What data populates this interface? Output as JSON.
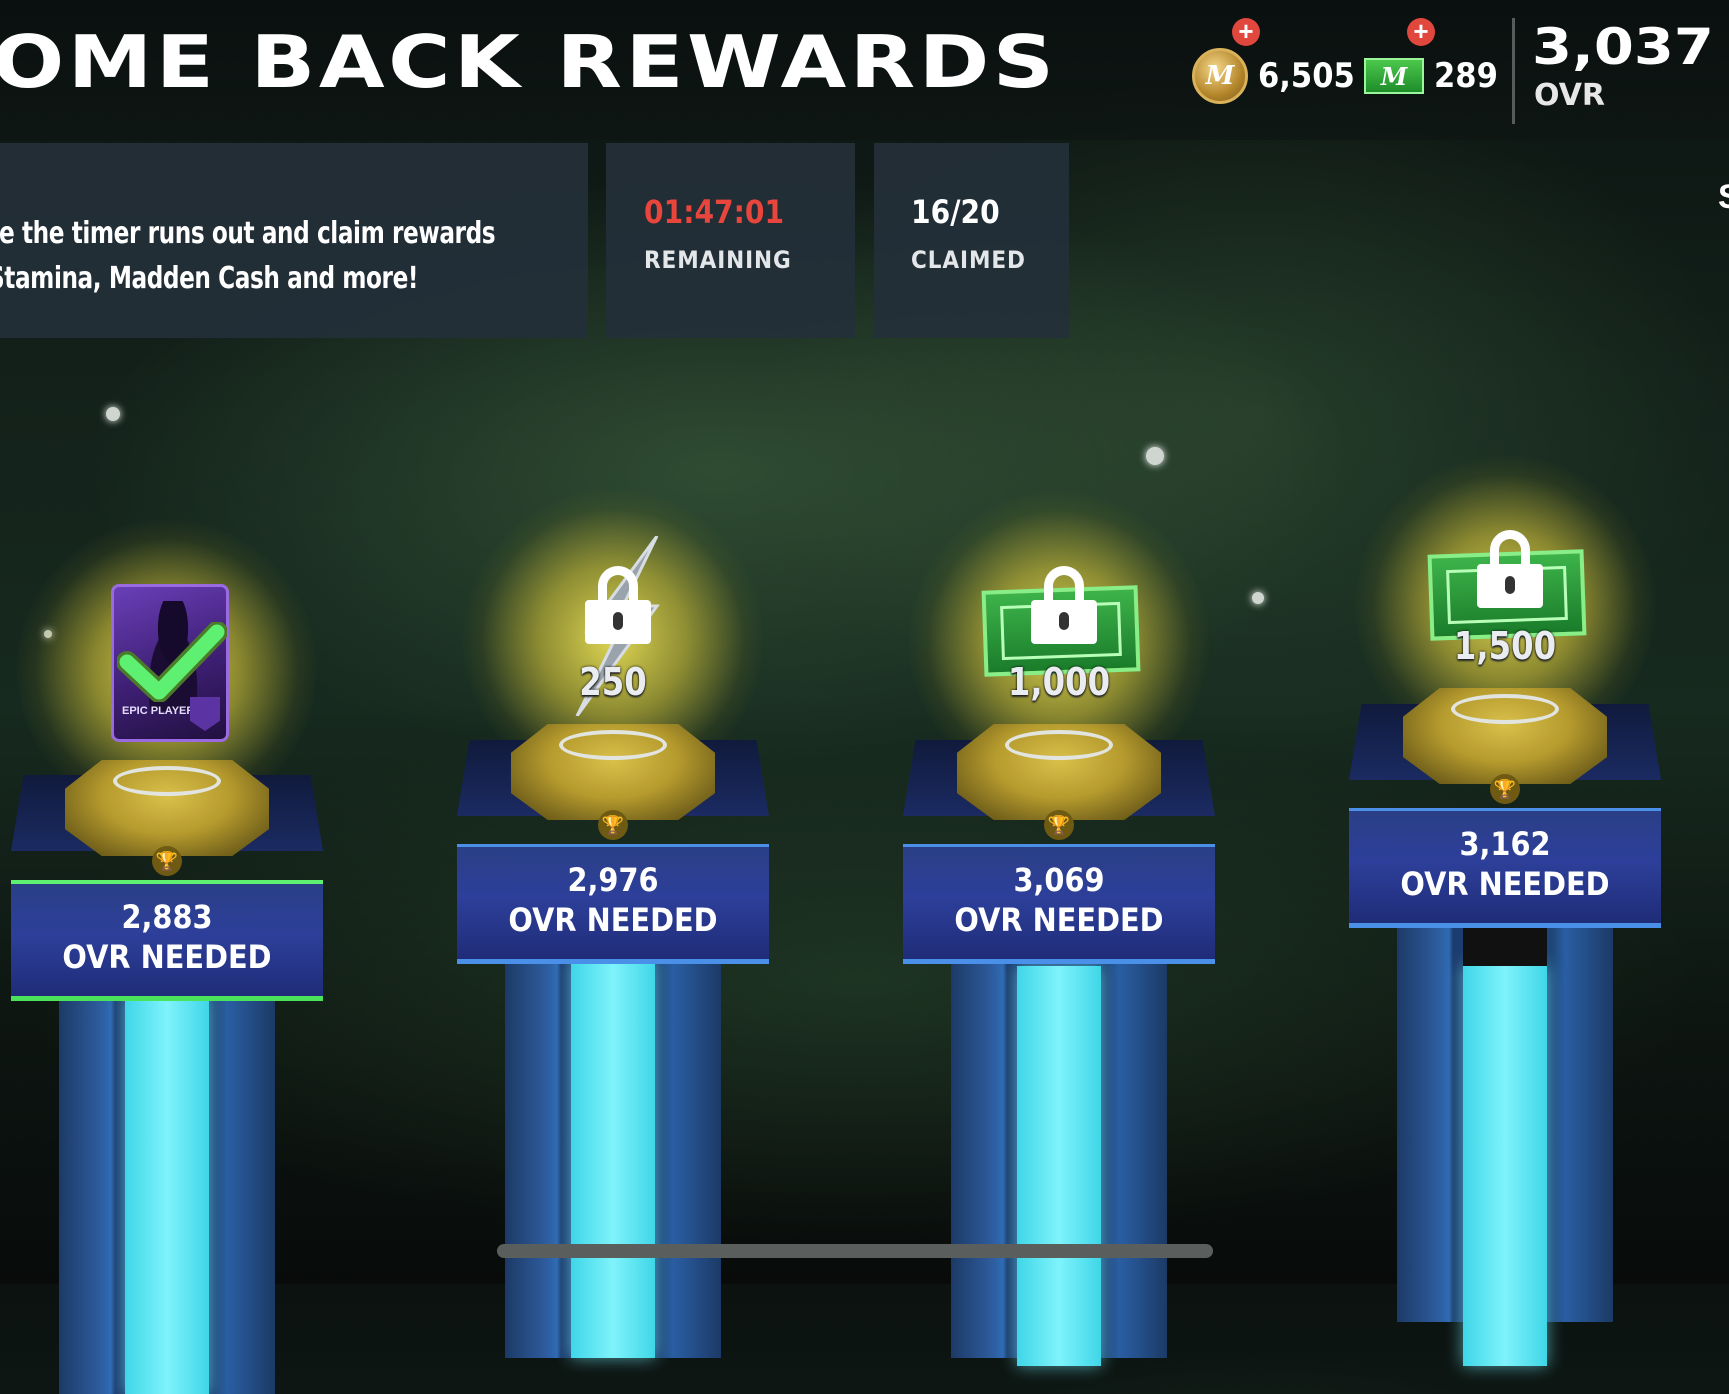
{
  "header": {
    "title": "OME BACK REWARDS",
    "coins": {
      "value": "6,505",
      "icon": "madden-coin-icon"
    },
    "cash": {
      "value": "289",
      "icon": "madden-cash-icon"
    },
    "ovr": {
      "value": "3,037",
      "label": "OVR"
    }
  },
  "info": {
    "description_line1": "re the timer runs out and claim rewards",
    "description_line2": "Stamina, Madden Cash and more!",
    "timer": {
      "value": "01:47:01",
      "label": "REMAINING",
      "color": "#e8453c"
    },
    "claimed": {
      "value": "16/20",
      "label": "CLAIMED"
    },
    "edge_text": "S"
  },
  "rewards": [
    {
      "amount": "",
      "type": "player-card",
      "card_label": "EPIC PLAYER",
      "status": "claimed",
      "ovr_needed": "2,883",
      "ovr_label": "OVR NEEDED"
    },
    {
      "amount": "250",
      "type": "stamina",
      "status": "locked",
      "ovr_needed": "2,976",
      "ovr_label": "OVR NEEDED"
    },
    {
      "amount": "1,000",
      "type": "madden-cash",
      "status": "locked",
      "ovr_needed": "3,069",
      "ovr_label": "OVR NEEDED"
    },
    {
      "amount": "1,500",
      "type": "madden-cash",
      "status": "locked",
      "ovr_needed": "3,162",
      "ovr_label": "OVR NEEDED"
    }
  ],
  "colors": {
    "claimed_accent": "#5ef070",
    "locked_accent": "#4a8fe8",
    "beam": "#7ff3fb"
  }
}
